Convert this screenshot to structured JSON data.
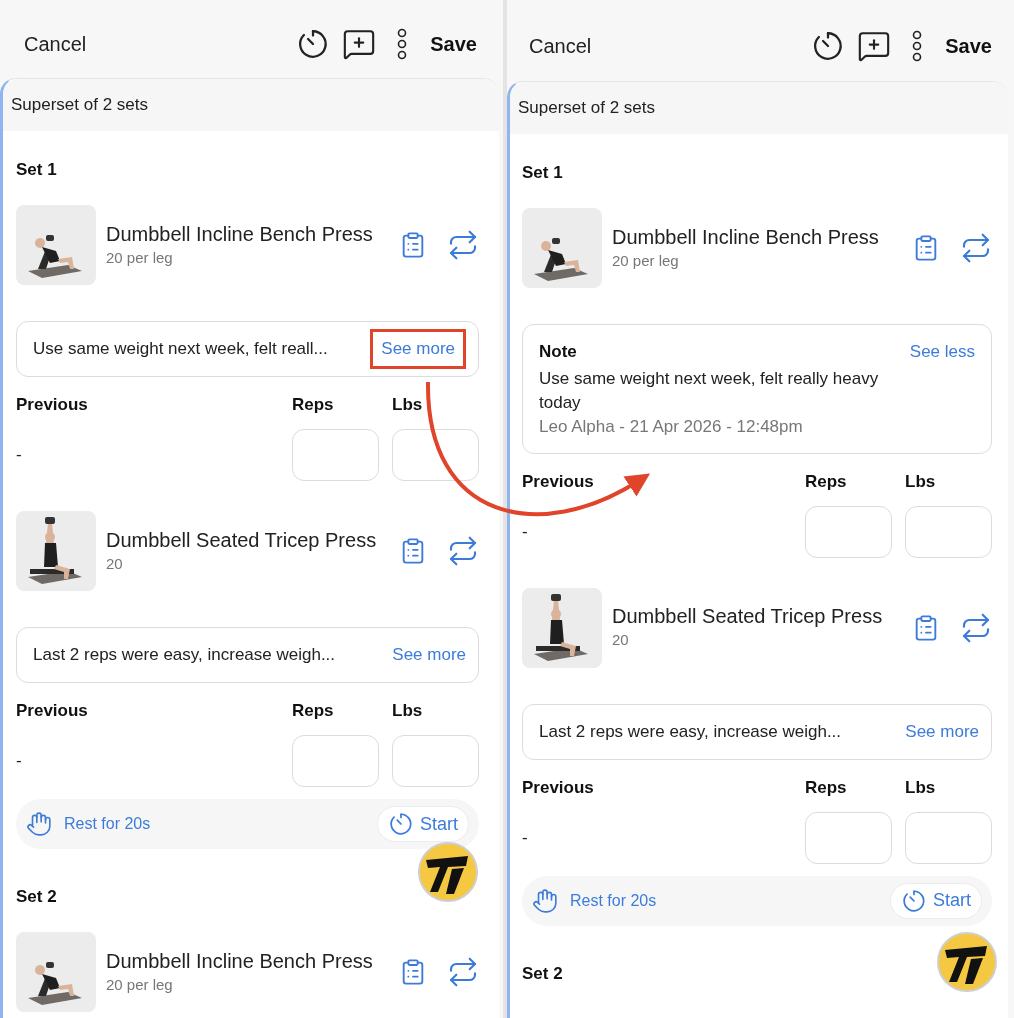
{
  "screens": [
    {
      "header": {
        "cancel": "Cancel",
        "save": "Save"
      },
      "superset_title": "Superset of 2 sets",
      "sets": [
        {
          "title": "Set 1",
          "exercises": [
            {
              "name": "Dumbbell Incline Bench Press",
              "detail": "20 per leg",
              "note": {
                "expanded": false,
                "text": "Use same weight next week, felt reall...",
                "link": "See more",
                "highlighted": true
              },
              "table": {
                "columns": [
                  "Previous",
                  "Reps",
                  "Lbs"
                ],
                "previous": "-"
              }
            },
            {
              "name": "Dumbbell Seated Tricep Press",
              "detail": "20",
              "note": {
                "expanded": false,
                "text": "Last 2 reps were easy, increase weigh...",
                "link": "See more",
                "highlighted": false
              },
              "table": {
                "columns": [
                  "Previous",
                  "Reps",
                  "Lbs"
                ],
                "previous": "-"
              }
            }
          ],
          "rest": {
            "label": "Rest for 20s",
            "button": "Start"
          }
        },
        {
          "title": "Set 2",
          "exercises": [
            {
              "name": "Dumbbell Incline Bench Press",
              "detail": "20 per leg"
            }
          ]
        }
      ]
    },
    {
      "header": {
        "cancel": "Cancel",
        "save": "Save"
      },
      "superset_title": "Superset of 2 sets",
      "sets": [
        {
          "title": "Set 1",
          "exercises": [
            {
              "name": "Dumbbell Incline Bench Press",
              "detail": "20 per leg",
              "note": {
                "expanded": true,
                "heading": "Note",
                "text": "Use same weight next week, felt really heavy today",
                "meta": "Leo Alpha - 21 Apr 2026 - 12:48pm",
                "link": "See less",
                "highlighted": false
              },
              "table": {
                "columns": [
                  "Previous",
                  "Reps",
                  "Lbs"
                ],
                "previous": "-"
              }
            },
            {
              "name": "Dumbbell Seated Tricep Press",
              "detail": "20",
              "note": {
                "expanded": false,
                "text": "Last 2 reps were easy, increase weigh...",
                "link": "See more",
                "highlighted": false
              },
              "table": {
                "columns": [
                  "Previous",
                  "Reps",
                  "Lbs"
                ],
                "previous": "-"
              }
            }
          ],
          "rest": {
            "label": "Rest for 20s",
            "button": "Start"
          }
        },
        {
          "title": "Set 2"
        }
      ]
    }
  ]
}
